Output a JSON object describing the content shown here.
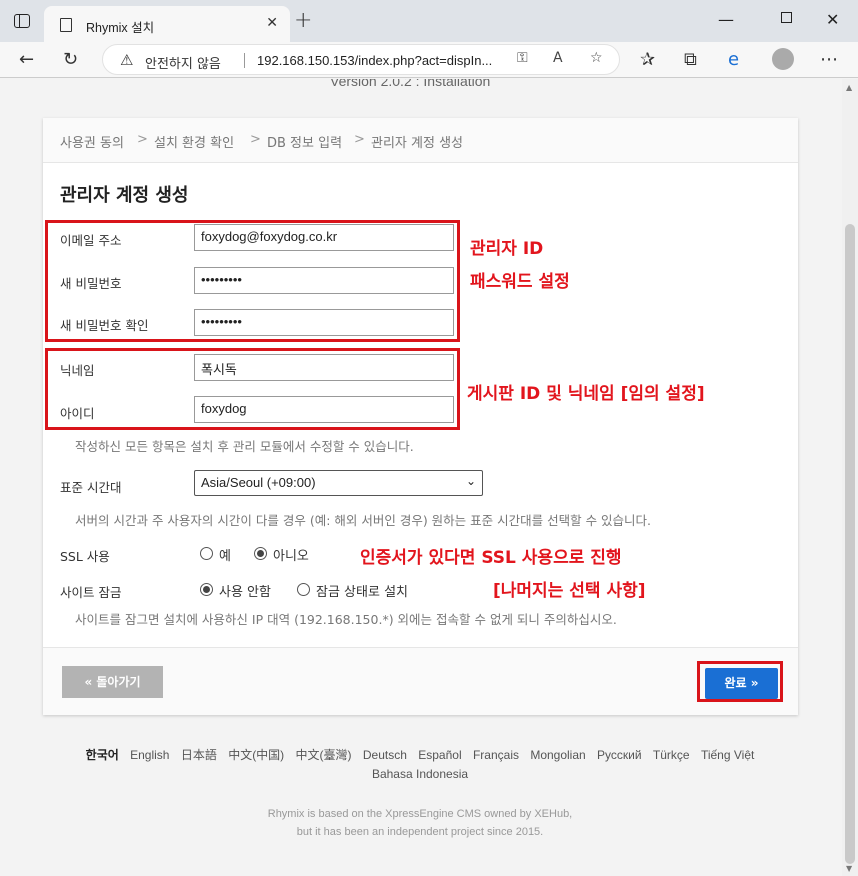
{
  "browser": {
    "tab_title": "Rhymix 설치",
    "security_label": "안전하지 않음",
    "url": "192.168.150.153/index.php?act=dispIn..."
  },
  "page": {
    "version_text": "Version 2.0.2 : Installation"
  },
  "steps": [
    "사용권 동의",
    "설치 환경 확인",
    "DB 정보 입력",
    "관리자 계정 생성"
  ],
  "step_separator": ">",
  "form": {
    "title": "관리자 계정 생성",
    "email": {
      "label": "이메일 주소",
      "value": "foxydog@foxydog.co.kr"
    },
    "password": {
      "label": "새 비밀번호",
      "value": "•••••••••"
    },
    "password_confirm": {
      "label": "새 비밀번호 확인",
      "value": "•••••••••"
    },
    "nickname": {
      "label": "닉네임",
      "value": "폭시독"
    },
    "user_id": {
      "label": "아이디",
      "value": "foxydog"
    },
    "edit_note": "작성하신 모든 항목은 설치 후 관리 모듈에서 수정할 수 있습니다.",
    "timezone": {
      "label": "표준 시간대",
      "value": "Asia/Seoul (+09:00)"
    },
    "timezone_note": "서버의 시간과 주 사용자의 시간이 다를 경우 (예: 해외 서버인 경우) 원하는 표준 시간대를 선택할 수 있습니다.",
    "ssl": {
      "label": "SSL 사용",
      "options": [
        "예",
        "아니오"
      ],
      "selected": "아니오"
    },
    "site_lock": {
      "label": "사이트 잠금",
      "options": [
        "사용 안함",
        "잠금 상태로 설치"
      ],
      "selected": "사용 안함"
    },
    "lock_note": "사이트를 잠그면 설치에 사용하신 IP 대역 (192.168.150.*) 외에는 접속할 수 없게 되니 주의하십시오.",
    "back_button": "« 돌아가기",
    "done_button": "완료 »"
  },
  "annotations": {
    "admin_id": "관리자 ID",
    "password_setup": "패스워드 설정",
    "board_id": "게시판 ID 및 닉네임 [임의 설정]",
    "ssl_note": "인증서가 있다면 SSL 사용으로 진행",
    "optional_note": "[나머지는 선택 사항]"
  },
  "languages": [
    "한국어",
    "English",
    "日本語",
    "中文(中国)",
    "中文(臺灣)",
    "Deutsch",
    "Español",
    "Français",
    "Mongolian",
    "Русский",
    "Türkçe",
    "Tiếng Việt",
    "Bahasa Indonesia"
  ],
  "active_language": "한국어",
  "credits": {
    "line1": "Rhymix is based on the XpressEngine CMS owned by XEHub,",
    "line2": "but it has been an independent project since 2015."
  },
  "colors": {
    "annotation_red": "#e2151d",
    "primary_button": "#1a6fd4",
    "back_button": "#b3b3b3"
  }
}
